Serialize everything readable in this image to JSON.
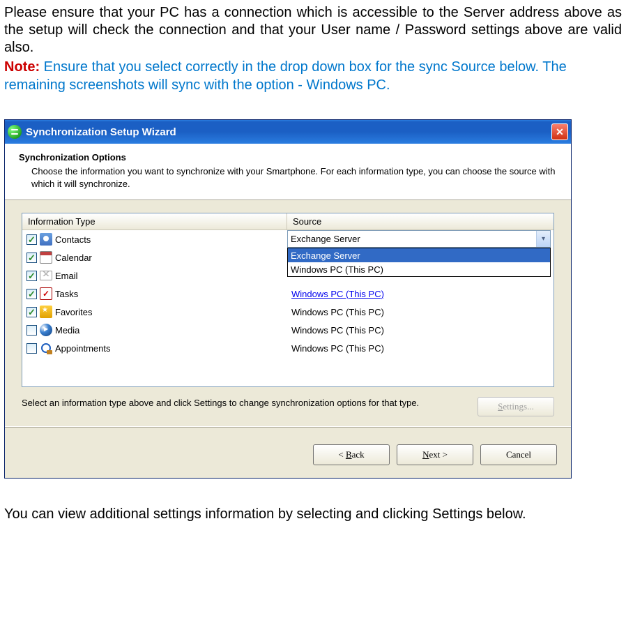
{
  "intro": "Please ensure that your PC has a connection which is accessible to the Server address above as the setup will check the connection and that your User name / Password settings above are valid also.",
  "note_label": "Note:",
  "note_text": " Ensure that you select correctly in the drop down box for the sync Source below. The remaining screenshots will sync with the option - Windows PC.",
  "wizard": {
    "title": "Synchronization Setup Wizard",
    "header_title": "Synchronization Options",
    "header_desc": "Choose the information you want to synchronize with your Smartphone.  For each information type, you can choose the source with which it will synchronize.",
    "columns": {
      "type": "Information Type",
      "source": "Source"
    },
    "rows": [
      {
        "checked": true,
        "icon": "contacts",
        "label": "Contacts",
        "source": "Exchange Server",
        "has_dropdown": true
      },
      {
        "checked": true,
        "icon": "calendar",
        "label": "Calendar",
        "source": ""
      },
      {
        "checked": true,
        "icon": "email",
        "label": "Email",
        "source": ""
      },
      {
        "checked": true,
        "icon": "tasks",
        "label": "Tasks",
        "source": "Windows PC (This PC)",
        "link": true
      },
      {
        "checked": true,
        "icon": "favorites",
        "label": "Favorites",
        "source": "Windows PC (This PC)"
      },
      {
        "checked": false,
        "icon": "media",
        "label": "Media",
        "source": "Windows PC (This PC)"
      },
      {
        "checked": false,
        "icon": "appointments",
        "label": "Appointments",
        "source": "Windows PC (This PC)"
      }
    ],
    "dropdown": {
      "selected": "Exchange Server",
      "options": [
        "Exchange Server",
        "Windows PC (This PC)"
      ],
      "highlighted_index": 0
    },
    "below_text": "Select an information type above and click Settings to change synchronization options for that type.",
    "settings_btn": "Settings...",
    "back_btn": "< Back",
    "next_btn": "Next >",
    "cancel_btn": "Cancel"
  },
  "outro": "You can view additional settings information by selecting and clicking Settings below."
}
